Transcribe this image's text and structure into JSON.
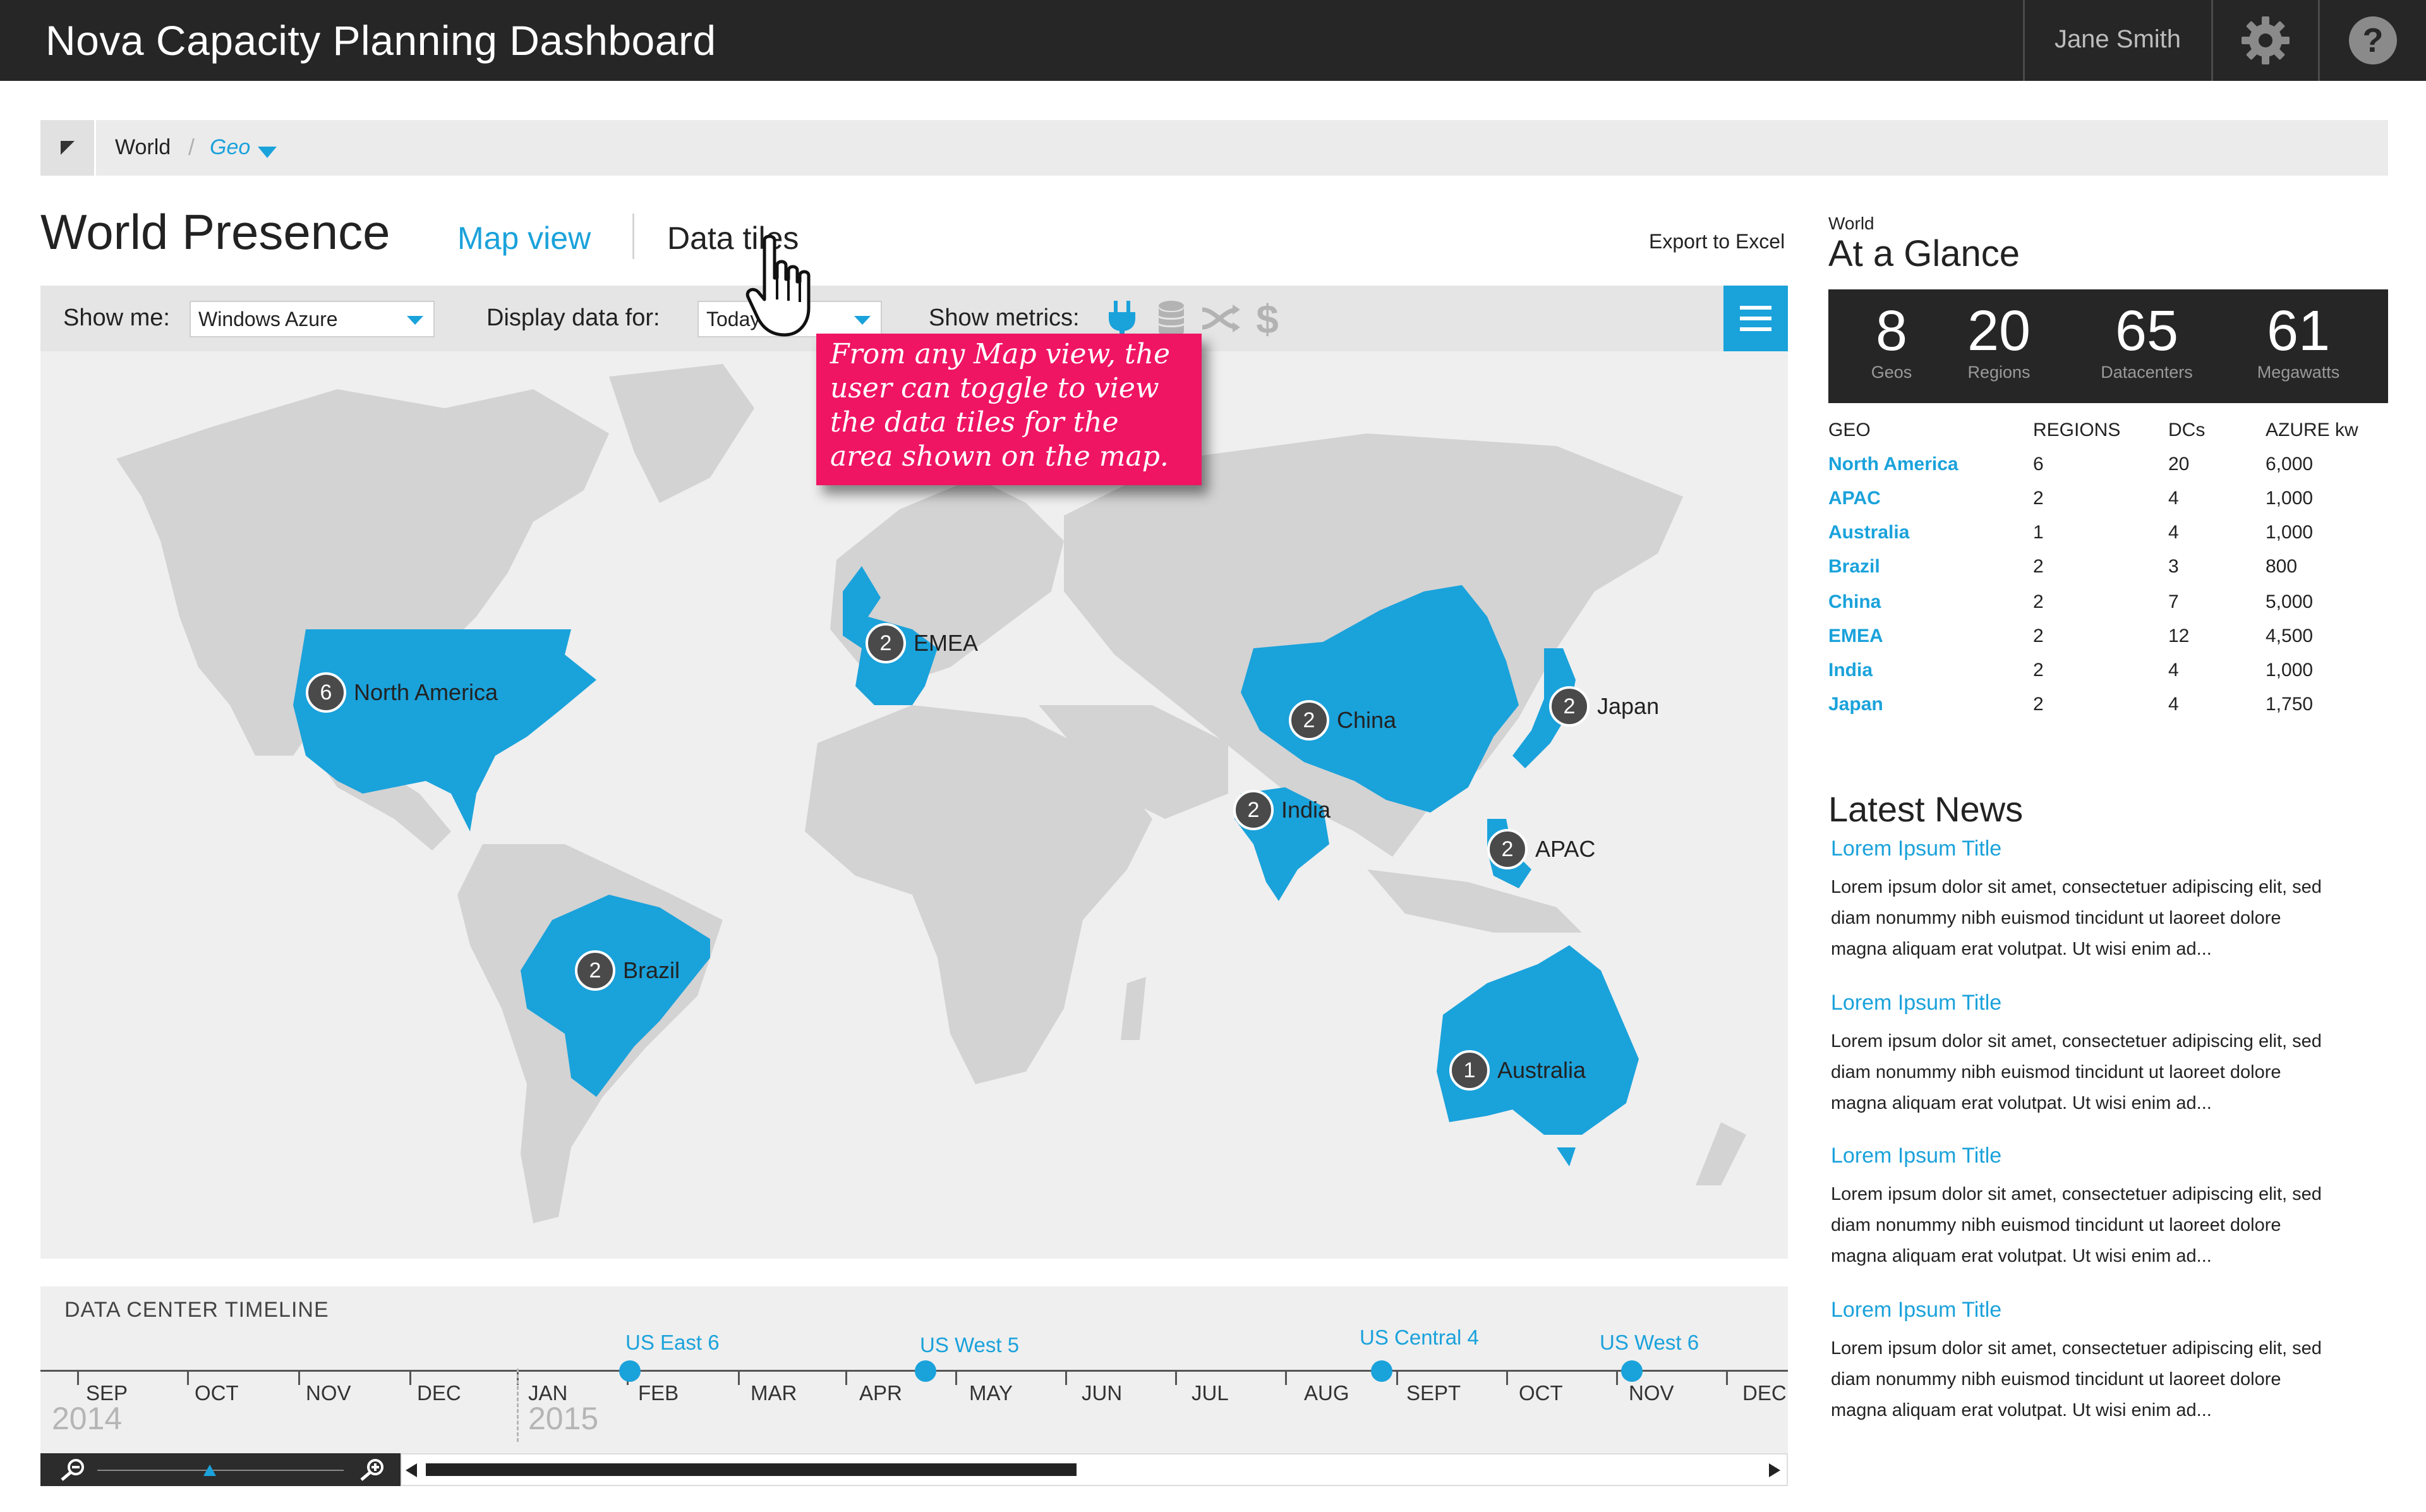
{
  "header": {
    "app_title": "Nova Capacity Planning Dashboard",
    "user_name": "Jane Smith",
    "icons": [
      "gear-icon",
      "help-icon"
    ]
  },
  "breadcrumb": {
    "root": "World",
    "separator": "/",
    "current": "Geo"
  },
  "page": {
    "title": "World Presence",
    "tabs": [
      {
        "label": "Map view",
        "active": true
      },
      {
        "label": "Data tiles",
        "active": false
      }
    ],
    "export_label": "Export to Excel"
  },
  "filters": {
    "show_me_label": "Show me:",
    "show_me_value": "Windows Azure",
    "display_label": "Display data for:",
    "display_value": "Today",
    "metrics_label": "Show metrics:",
    "metrics": [
      {
        "icon": "plug-icon",
        "active": true
      },
      {
        "icon": "database-icon",
        "active": false
      },
      {
        "icon": "network-icon",
        "active": false
      },
      {
        "icon": "dollar-icon",
        "active": false
      }
    ]
  },
  "callout": {
    "lines": [
      "From any Map view, the",
      "user can toggle to view",
      "the data tiles for the",
      "area shown on the map."
    ]
  },
  "map": {
    "highlight_color": "#1aa2db",
    "pins": [
      {
        "count": "6",
        "label": "North America"
      },
      {
        "count": "2",
        "label": "EMEA"
      },
      {
        "count": "2",
        "label": "China"
      },
      {
        "count": "2",
        "label": "Japan"
      },
      {
        "count": "2",
        "label": "India"
      },
      {
        "count": "2",
        "label": "APAC"
      },
      {
        "count": "2",
        "label": "Brazil"
      },
      {
        "count": "1",
        "label": "Australia"
      }
    ]
  },
  "timeline": {
    "title": "DATA CENTER TIMELINE",
    "months": [
      "SEP",
      "OCT",
      "NOV",
      "DEC",
      "JAN",
      "FEB",
      "MAR",
      "APR",
      "MAY",
      "JUN",
      "JUL",
      "AUG",
      "SEPT",
      "OCT",
      "NOV",
      "DEC"
    ],
    "years": [
      "2014",
      "2015"
    ],
    "events": [
      "US East 6",
      "US West 5",
      "US Central 4",
      "US West 6"
    ]
  },
  "glance": {
    "scope": "World",
    "title": "At a Glance",
    "stats": [
      {
        "value": "8",
        "label": "Geos"
      },
      {
        "value": "20",
        "label": "Regions"
      },
      {
        "value": "65",
        "label": "Datacenters"
      },
      {
        "value": "61",
        "label": "Megawatts"
      }
    ],
    "columns": [
      "GEO",
      "REGIONS",
      "DCs",
      "AZURE kw"
    ],
    "rows": [
      {
        "geo": "North America",
        "regions": "6",
        "dcs": "20",
        "kw": "6,000"
      },
      {
        "geo": "APAC",
        "regions": "2",
        "dcs": "4",
        "kw": "1,000"
      },
      {
        "geo": "Australia",
        "regions": "1",
        "dcs": "4",
        "kw": "1,000"
      },
      {
        "geo": "Brazil",
        "regions": "2",
        "dcs": "3",
        "kw": "800"
      },
      {
        "geo": "China",
        "regions": "2",
        "dcs": "7",
        "kw": "5,000"
      },
      {
        "geo": "EMEA",
        "regions": "2",
        "dcs": "12",
        "kw": "4,500"
      },
      {
        "geo": "India",
        "regions": "2",
        "dcs": "4",
        "kw": "1,000"
      },
      {
        "geo": "Japan",
        "regions": "2",
        "dcs": "4",
        "kw": "1,750"
      }
    ]
  },
  "news": {
    "title": "Latest News",
    "items": [
      {
        "title": "Lorem Ipsum Title",
        "lines": [
          "Lorem ipsum dolor sit amet, consectetuer adipiscing elit, sed",
          "diam nonummy nibh euismod tincidunt ut laoreet dolore",
          "magna aliquam erat volutpat. Ut wisi enim ad..."
        ]
      },
      {
        "title": "Lorem Ipsum Title",
        "lines": [
          "Lorem ipsum dolor sit amet, consectetuer adipiscing elit, sed",
          "diam nonummy nibh euismod tincidunt ut laoreet dolore",
          "magna aliquam erat volutpat. Ut wisi enim ad..."
        ]
      },
      {
        "title": "Lorem Ipsum Title",
        "lines": [
          "Lorem ipsum dolor sit amet, consectetuer adipiscing elit, sed",
          "diam nonummy nibh euismod tincidunt ut laoreet dolore",
          "magna aliquam erat volutpat. Ut wisi enim ad..."
        ]
      },
      {
        "title": "Lorem Ipsum Title",
        "lines": [
          "Lorem ipsum dolor sit amet, consectetuer adipiscing elit, sed",
          "diam nonummy nibh euismod tincidunt ut laoreet dolore",
          "magna aliquam erat volutpat. Ut wisi enim ad..."
        ]
      }
    ]
  }
}
